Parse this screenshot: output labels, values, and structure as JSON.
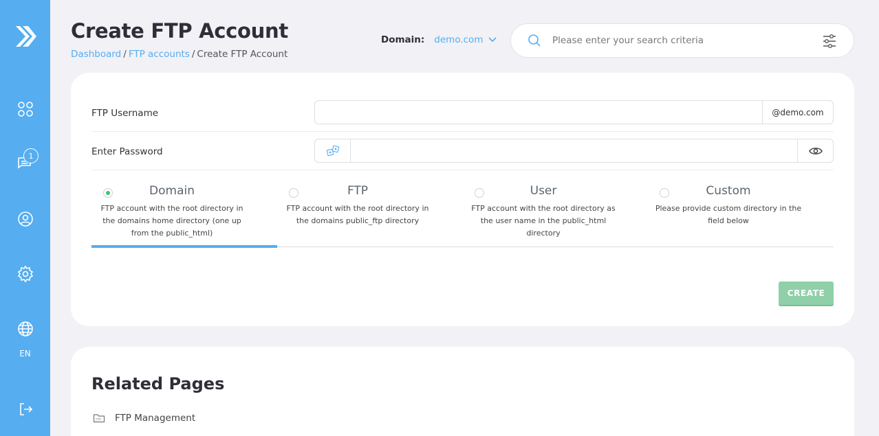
{
  "sidebar": {
    "logo_icon": "chevron-right-logo",
    "items": [
      {
        "name": "dashboard",
        "icon": "grid-icon"
      },
      {
        "name": "messages",
        "icon": "chat-icon",
        "badge": "1"
      },
      {
        "name": "account",
        "icon": "user-icon"
      },
      {
        "name": "settings",
        "icon": "gear-icon"
      },
      {
        "name": "language",
        "icon": "globe-icon",
        "label": "EN"
      },
      {
        "name": "logout",
        "icon": "logout-icon"
      }
    ]
  },
  "header": {
    "title": "Create FTP Account",
    "breadcrumb": [
      "Dashboard",
      "FTP accounts",
      "Create FTP Account"
    ],
    "domain_label": "Domain:",
    "domain_value": "demo.com",
    "search_placeholder": "Please enter your search criteria"
  },
  "form": {
    "username_label": "FTP Username",
    "username_value": "",
    "username_suffix": "@demo.com",
    "password_label": "Enter Password",
    "password_value": "",
    "options": [
      {
        "title": "Domain",
        "desc": "FTP account with the root directory in the domains home directory (one up from the public_html)",
        "selected": true
      },
      {
        "title": "FTP",
        "desc": "FTP account with the root directory in the domains public_ftp directory",
        "selected": false
      },
      {
        "title": "User",
        "desc": "FTP account with the root directory as the user name in the public_html directory",
        "selected": false
      },
      {
        "title": "Custom",
        "desc": "Please provide custom directory in the field below",
        "selected": false
      }
    ],
    "create_label": "CREATE"
  },
  "related": {
    "title": "Related Pages",
    "items": [
      {
        "label": "FTP Management",
        "icon": "ftp-folder-icon"
      }
    ]
  },
  "colors": {
    "sidebar": "#56adf0",
    "accent": "#56adf0",
    "create_button": "#8fd0a9",
    "radio_selected": "#3cc47c",
    "background": "#f1f1f6"
  }
}
